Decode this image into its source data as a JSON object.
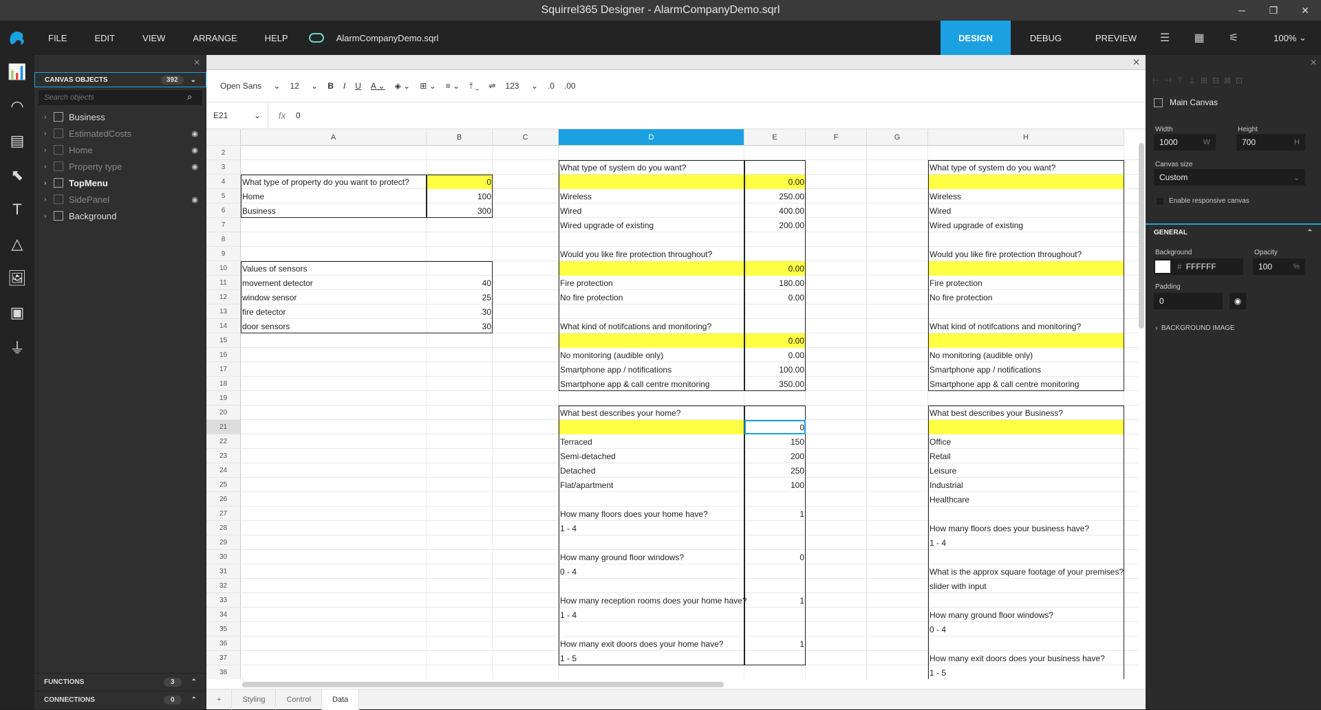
{
  "window": {
    "title": "Squirrel365 Designer - AlarmCompanyDemo.sqrl"
  },
  "menu": {
    "items": [
      "FILE",
      "EDIT",
      "VIEW",
      "ARRANGE",
      "HELP"
    ],
    "filename": "AlarmCompanyDemo.sqrl"
  },
  "modes": {
    "design": "DESIGN",
    "debug": "DEBUG",
    "preview": "PREVIEW"
  },
  "zoom": "100%",
  "left_panel": {
    "header": "CANVAS OBJECTS",
    "count": "392",
    "search_placeholder": "Search objects",
    "items": [
      {
        "label": "Business",
        "style": "normal",
        "eye": false
      },
      {
        "label": "EstimatedCosts",
        "style": "dim",
        "eye": true
      },
      {
        "label": "Home",
        "style": "dim",
        "eye": true
      },
      {
        "label": "Property type",
        "style": "dim",
        "eye": true
      },
      {
        "label": "TopMenu",
        "style": "bold",
        "eye": false
      },
      {
        "label": "SidePanel",
        "style": "dim",
        "eye": true
      },
      {
        "label": "Background",
        "style": "normal",
        "eye": false
      }
    ],
    "functions_label": "FUNCTIONS",
    "functions_count": "3",
    "connections_label": "CONNECTIONS",
    "connections_count": "0"
  },
  "toolbar": {
    "font": "Open Sans",
    "size": "12",
    "number_format": "123"
  },
  "formula": {
    "cell": "E21",
    "value": "0"
  },
  "grid": {
    "columns": [
      "A",
      "B",
      "C",
      "D",
      "E",
      "F",
      "G",
      "H"
    ],
    "selected_column": "D",
    "rows": [
      "2",
      "3",
      "4",
      "5",
      "6",
      "7",
      "8",
      "9",
      "10",
      "11",
      "12",
      "13",
      "14",
      "15",
      "16",
      "17",
      "18",
      "19",
      "20",
      "21",
      "22",
      "23",
      "24",
      "25",
      "26",
      "27",
      "28",
      "29",
      "30",
      "31",
      "32",
      "33",
      "34",
      "35",
      "36",
      "37",
      "38"
    ],
    "cells": [
      {
        "c": "A",
        "r": 4,
        "t": "What type of property do you want to protect?"
      },
      {
        "c": "B",
        "r": 4,
        "t": "0",
        "a": "r"
      },
      {
        "c": "A",
        "r": 5,
        "t": "Home"
      },
      {
        "c": "B",
        "r": 5,
        "t": "100",
        "a": "r"
      },
      {
        "c": "A",
        "r": 6,
        "t": "Business"
      },
      {
        "c": "B",
        "r": 6,
        "t": "300",
        "a": "r"
      },
      {
        "c": "A",
        "r": 10,
        "t": "Values of sensors"
      },
      {
        "c": "A",
        "r": 11,
        "t": "movement detector"
      },
      {
        "c": "B",
        "r": 11,
        "t": "40",
        "a": "r"
      },
      {
        "c": "A",
        "r": 12,
        "t": "window sensor"
      },
      {
        "c": "B",
        "r": 12,
        "t": "25",
        "a": "r"
      },
      {
        "c": "A",
        "r": 13,
        "t": "fire detector"
      },
      {
        "c": "B",
        "r": 13,
        "t": "30",
        "a": "r"
      },
      {
        "c": "A",
        "r": 14,
        "t": "door sensors"
      },
      {
        "c": "B",
        "r": 14,
        "t": "30",
        "a": "r"
      },
      {
        "c": "D",
        "r": 3,
        "t": "What type of system do you want?"
      },
      {
        "c": "E",
        "r": 4,
        "t": "0.00",
        "a": "r"
      },
      {
        "c": "D",
        "r": 5,
        "t": "Wireless"
      },
      {
        "c": "E",
        "r": 5,
        "t": "250.00",
        "a": "r"
      },
      {
        "c": "D",
        "r": 6,
        "t": "Wired"
      },
      {
        "c": "E",
        "r": 6,
        "t": "400.00",
        "a": "r"
      },
      {
        "c": "D",
        "r": 7,
        "t": "Wired upgrade of existing"
      },
      {
        "c": "E",
        "r": 7,
        "t": "200.00",
        "a": "r"
      },
      {
        "c": "D",
        "r": 9,
        "t": "Would you like fire protection throughout?"
      },
      {
        "c": "E",
        "r": 10,
        "t": "0.00",
        "a": "r"
      },
      {
        "c": "D",
        "r": 11,
        "t": "Fire protection"
      },
      {
        "c": "E",
        "r": 11,
        "t": "180.00",
        "a": "r"
      },
      {
        "c": "D",
        "r": 12,
        "t": "No fire protection"
      },
      {
        "c": "E",
        "r": 12,
        "t": "0.00",
        "a": "r"
      },
      {
        "c": "D",
        "r": 14,
        "t": "What kind of notifcations and monitoring?"
      },
      {
        "c": "E",
        "r": 15,
        "t": "0.00",
        "a": "r"
      },
      {
        "c": "D",
        "r": 16,
        "t": "No monitoring (audible only)"
      },
      {
        "c": "E",
        "r": 16,
        "t": "0.00",
        "a": "r"
      },
      {
        "c": "D",
        "r": 17,
        "t": "Smartphone app / notifications"
      },
      {
        "c": "E",
        "r": 17,
        "t": "100.00",
        "a": "r"
      },
      {
        "c": "D",
        "r": 18,
        "t": "Smartphone app & call centre monitoring"
      },
      {
        "c": "E",
        "r": 18,
        "t": "350.00",
        "a": "r"
      },
      {
        "c": "D",
        "r": 20,
        "t": "What best describes your home?"
      },
      {
        "c": "E",
        "r": 21,
        "t": "0",
        "a": "r"
      },
      {
        "c": "D",
        "r": 22,
        "t": "Terraced"
      },
      {
        "c": "E",
        "r": 22,
        "t": "150",
        "a": "r"
      },
      {
        "c": "D",
        "r": 23,
        "t": "Semi-detached"
      },
      {
        "c": "E",
        "r": 23,
        "t": "200",
        "a": "r"
      },
      {
        "c": "D",
        "r": 24,
        "t": "Detached"
      },
      {
        "c": "E",
        "r": 24,
        "t": "250",
        "a": "r"
      },
      {
        "c": "D",
        "r": 25,
        "t": "Flat/apartment"
      },
      {
        "c": "E",
        "r": 25,
        "t": "100",
        "a": "r"
      },
      {
        "c": "D",
        "r": 27,
        "t": "How many floors does your home have?"
      },
      {
        "c": "E",
        "r": 27,
        "t": "1",
        "a": "r"
      },
      {
        "c": "D",
        "r": 28,
        "t": "1 - 4"
      },
      {
        "c": "D",
        "r": 30,
        "t": "How many ground floor windows?"
      },
      {
        "c": "E",
        "r": 30,
        "t": "0",
        "a": "r"
      },
      {
        "c": "D",
        "r": 31,
        "t": "0 - 4"
      },
      {
        "c": "D",
        "r": 33,
        "t": "How many reception rooms does your home have?"
      },
      {
        "c": "E",
        "r": 33,
        "t": "1",
        "a": "r"
      },
      {
        "c": "D",
        "r": 34,
        "t": "1 - 4"
      },
      {
        "c": "D",
        "r": 36,
        "t": "How many exit doors does your home have?"
      },
      {
        "c": "E",
        "r": 36,
        "t": "1",
        "a": "r"
      },
      {
        "c": "D",
        "r": 37,
        "t": "1 - 5"
      },
      {
        "c": "H",
        "r": 3,
        "t": "What type of system do you want?"
      },
      {
        "c": "H",
        "r": 5,
        "t": "Wireless"
      },
      {
        "c": "H",
        "r": 6,
        "t": "Wired"
      },
      {
        "c": "H",
        "r": 7,
        "t": "Wired upgrade of existing"
      },
      {
        "c": "H",
        "r": 9,
        "t": "Would you like fire protection throughout?"
      },
      {
        "c": "H",
        "r": 11,
        "t": "Fire protection"
      },
      {
        "c": "H",
        "r": 12,
        "t": "No fire protection"
      },
      {
        "c": "H",
        "r": 14,
        "t": "What kind of notifcations and monitoring?"
      },
      {
        "c": "H",
        "r": 16,
        "t": "No monitoring (audible only)"
      },
      {
        "c": "H",
        "r": 17,
        "t": "Smartphone app / notifications"
      },
      {
        "c": "H",
        "r": 18,
        "t": "Smartphone app & call centre monitoring"
      },
      {
        "c": "H",
        "r": 20,
        "t": "What best describes your Business?"
      },
      {
        "c": "H",
        "r": 22,
        "t": "Office"
      },
      {
        "c": "H",
        "r": 23,
        "t": "Retail"
      },
      {
        "c": "H",
        "r": 24,
        "t": "Leisure"
      },
      {
        "c": "H",
        "r": 25,
        "t": "Industrial"
      },
      {
        "c": "H",
        "r": 26,
        "t": "Healthcare"
      },
      {
        "c": "H",
        "r": 28,
        "t": "How many floors does your business have?"
      },
      {
        "c": "H",
        "r": 29,
        "t": "1 - 4"
      },
      {
        "c": "H",
        "r": 31,
        "t": "What is the approx square footage of your premises?"
      },
      {
        "c": "H",
        "r": 32,
        "t": "slider with input"
      },
      {
        "c": "H",
        "r": 34,
        "t": "How many ground floor windows?"
      },
      {
        "c": "H",
        "r": 35,
        "t": "0 - 4"
      },
      {
        "c": "H",
        "r": 37,
        "t": "How many exit doors does your business have?"
      },
      {
        "c": "H",
        "r": 38,
        "t": "1 - 5"
      }
    ]
  },
  "sheet_tabs": [
    "Styling",
    "Control",
    "Data"
  ],
  "active_tab": "Data",
  "right_panel": {
    "title": "Main Canvas",
    "width_label": "Width",
    "width_value": "1000",
    "width_unit": "W",
    "height_label": "Height",
    "height_value": "700",
    "height_unit": "H",
    "canvas_size_label": "Canvas size",
    "canvas_size_value": "Custom",
    "responsive_label": "Enable responsive canvas",
    "general_label": "GENERAL",
    "background_label": "Background",
    "background_value": "FFFFFF",
    "background_prefix": "#",
    "opacity_label": "Opacity",
    "opacity_value": "100",
    "opacity_unit": "%",
    "padding_label": "Padding",
    "padding_value": "0",
    "bg_image_label": "BACKGROUND IMAGE"
  },
  "colors": {
    "accent": "#1ba1e2",
    "highlight": "#ffff44"
  }
}
